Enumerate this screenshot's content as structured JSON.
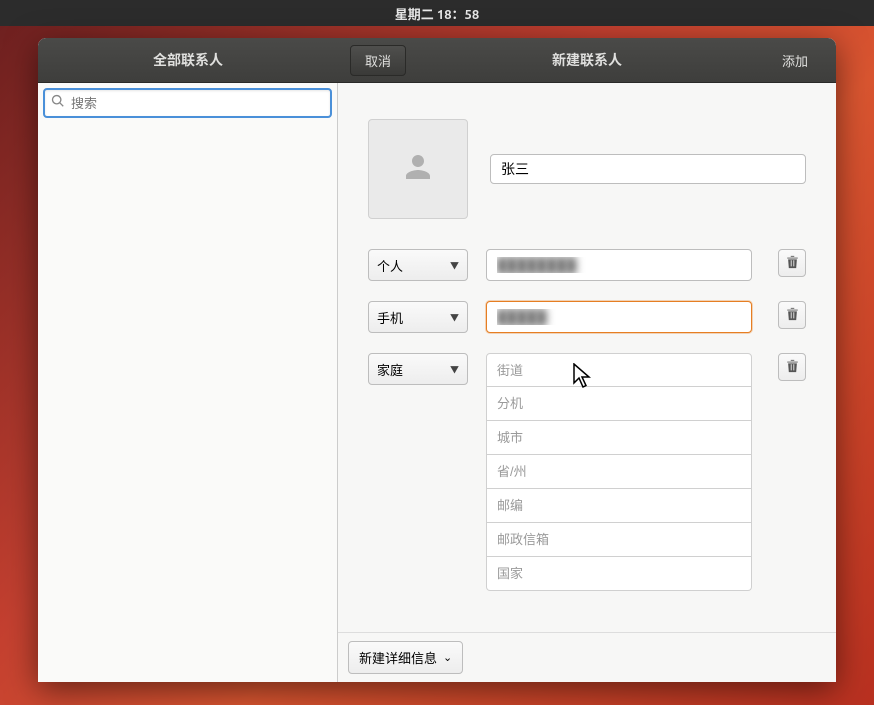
{
  "topbar": {
    "datetime": "星期二 18：58"
  },
  "titlebar": {
    "left_title": "全部联系人",
    "cancel_label": "取消",
    "center_title": "新建联系人",
    "add_label": "添加"
  },
  "sidebar": {
    "search_placeholder": "搜索"
  },
  "form": {
    "name_value": "张三",
    "rows": [
      {
        "type_label": "个人",
        "value": "████████"
      },
      {
        "type_label": "手机",
        "value": "█████"
      },
      {
        "type_label": "家庭"
      }
    ],
    "address": {
      "street": "街道",
      "extension": "分机",
      "city": "城市",
      "state": "省/州",
      "zip": "邮编",
      "pobox": "邮政信箱",
      "country": "国家"
    }
  },
  "bottom": {
    "new_detail_label": "新建详细信息"
  }
}
